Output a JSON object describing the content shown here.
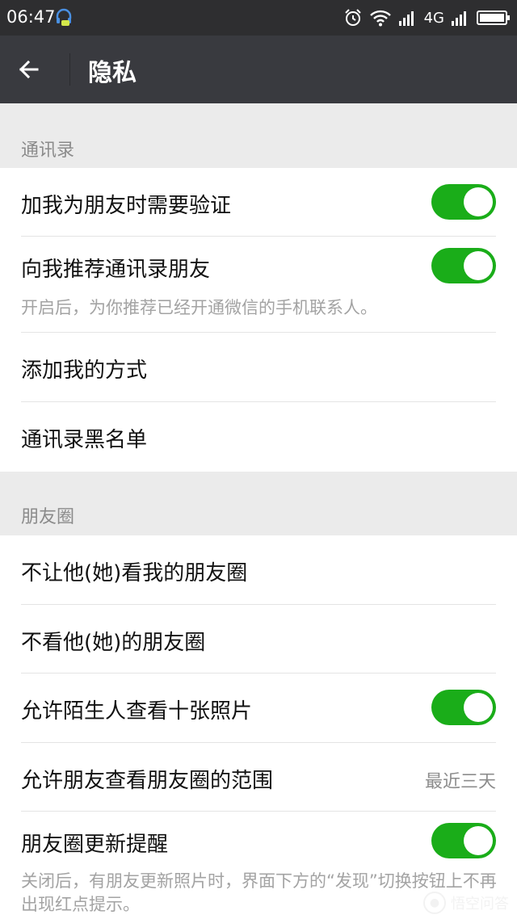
{
  "status_bar": {
    "time": "06:47",
    "network": "4G",
    "icons": [
      "headset-icon",
      "alarm-icon",
      "wifi-icon",
      "signal-icon",
      "battery-icon"
    ]
  },
  "header": {
    "title": "隐私",
    "back_icon": "arrow-left-icon"
  },
  "colors": {
    "status_bar_bg": "#2e2e30",
    "header_bg": "#393a3f",
    "page_bg": "#ebebeb",
    "toggle_on": "#1aad19"
  },
  "sections": {
    "contacts": {
      "title": "通讯录",
      "items": [
        {
          "label": "加我为朋友时需要验证",
          "toggle": true
        },
        {
          "label": "向我推荐通讯录朋友",
          "toggle": true,
          "description": "开启后，为你推荐已经开通微信的手机联系人。"
        },
        {
          "label": "添加我的方式"
        },
        {
          "label": "通讯录黑名单"
        }
      ]
    },
    "moments": {
      "title": "朋友圈",
      "items": [
        {
          "label": "不让他(她)看我的朋友圈"
        },
        {
          "label": "不看他(她)的朋友圈"
        },
        {
          "label": "允许陌生人查看十张照片",
          "toggle": true
        },
        {
          "label": "允许朋友查看朋友圈的范围",
          "value": "最近三天"
        },
        {
          "label": "朋友圈更新提醒",
          "toggle": true,
          "description": "关闭后，有朋友更新照片时，界面下方的“发现”切换按钮上不再出现红点提示。"
        }
      ]
    }
  },
  "watermark": {
    "text": "悟空问答"
  }
}
